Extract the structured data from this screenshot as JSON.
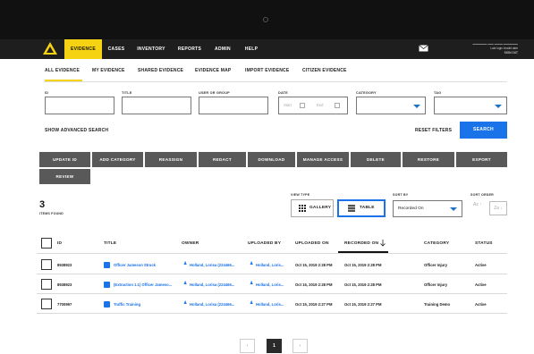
{
  "topnav": {
    "items": [
      {
        "label": "EVIDENCE",
        "active": true
      },
      {
        "label": "CASES",
        "active": false
      },
      {
        "label": "INVENTORY",
        "active": false
      },
      {
        "label": "REPORTS",
        "active": false
      },
      {
        "label": "ADMIN",
        "active": false
      },
      {
        "label": "HELP",
        "active": false
      }
    ],
    "user": {
      "last_login": "Last login invalid date",
      "sign_out": "SIGN OUT"
    },
    "accent_color": "#f6d312"
  },
  "subnav": {
    "tabs": [
      {
        "label": "ALL EVIDENCE",
        "active": true
      },
      {
        "label": "MY EVIDENCE",
        "active": false
      },
      {
        "label": "SHARED EVIDENCE",
        "active": false
      },
      {
        "label": "EVIDENCE MAP",
        "active": false
      },
      {
        "label": "IMPORT EVIDENCE",
        "active": false
      },
      {
        "label": "CITIZEN EVIDENCE",
        "active": false
      }
    ]
  },
  "filters": {
    "id_label": "ID",
    "title_label": "TITLE",
    "user_label": "USER OR GROUP",
    "date_label": "DATE",
    "date_start_placeholder": "Start",
    "date_end_placeholder": "End",
    "category_label": "CATEGORY",
    "tag_label": "TAG",
    "advanced_search": "SHOW ADVANCED SEARCH",
    "reset": "RESET FILTERS",
    "search": "SEARCH"
  },
  "actions": {
    "update_id": "UPDATE ID",
    "add_category": "ADD CATEGORY",
    "reassign": "REASSIGN",
    "redact": "REDACT",
    "download": "DOWNLOAD",
    "manage_access": "MANAGE ACCESS",
    "delete": "DELETE",
    "restore": "RESTORE",
    "export": "EXPORT",
    "review": "REVIEW"
  },
  "results": {
    "count": "3",
    "items_found": "ITEMS FOUND",
    "view_type_label": "VIEW TYPE",
    "gallery": "GALLERY",
    "table": "TABLE",
    "sort_by_label": "SORT BY",
    "sort_by_value": "Recorded On",
    "sort_order_label": "SORT ORDER",
    "sort_asc": "Az ↑",
    "sort_desc": "Za ↓"
  },
  "table": {
    "columns": {
      "id": "ID",
      "title": "TITLE",
      "owner": "OWNER",
      "uploaded_by": "UPLOADED BY",
      "uploaded_on": "UPLOADED ON",
      "recorded_on": "RECORDED ON",
      "category": "CATEGORY",
      "status": "STATUS"
    },
    "rows": [
      {
        "id": "8938923",
        "title": "Officer Jameson Struck",
        "owner": "Holland, Lorisa (224466...",
        "uploaded_by": "Holland, Loris...",
        "uploaded_on": "Oct 15, 2019 2:28 PM",
        "recorded_on": "Oct 15, 2019 2:28 PM",
        "category": "Officer Injury",
        "status": "Active"
      },
      {
        "id": "8938923",
        "title": "(Extraction 1.1) Officer Jameso...",
        "owner": "Holland, Lorisa (224466...",
        "uploaded_by": "Holland, Loris...",
        "uploaded_on": "Oct 15, 2019 2:28 PM",
        "recorded_on": "Oct 15, 2019 2:28 PM",
        "category": "Officer Injury",
        "status": "Active"
      },
      {
        "id": "7700997",
        "title": "Traffic Training",
        "owner": "Holland, Lorisa (224466...",
        "uploaded_by": "Holland, Loris...",
        "uploaded_on": "Oct 15, 2019 2:27 PM",
        "recorded_on": "Oct 15, 2019 2:27 PM",
        "category": "Training Demo",
        "status": "Active"
      }
    ]
  },
  "pagination": {
    "prev": "‹",
    "current": "1",
    "next": "›"
  },
  "icons": {
    "logo": "triangle-logo-icon",
    "mail": "envelope-icon",
    "calendar": "calendar-icon",
    "file": "file-icon",
    "user": "user-icon",
    "gallery": "grid-icon",
    "table": "list-icon",
    "sort_arrow": "arrow-down-icon"
  },
  "colors": {
    "primary_blue": "#1a73e8",
    "dark": "#111111",
    "button_gray": "#595959"
  }
}
